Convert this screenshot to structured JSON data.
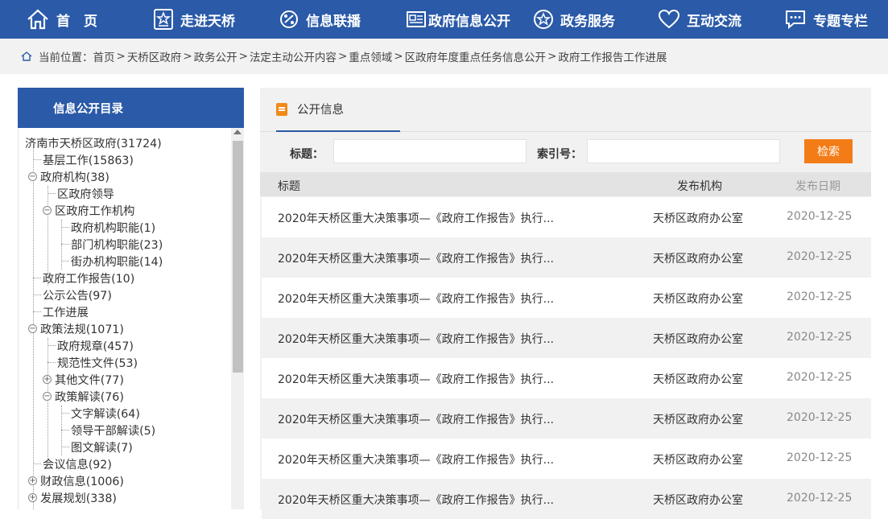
{
  "nav": {
    "items": [
      {
        "label": "首　页",
        "icon": "home-icon"
      },
      {
        "label": "走进天桥",
        "icon": "star-badge-icon"
      },
      {
        "label": "信息联播",
        "icon": "broadcast-icon"
      },
      {
        "label": "政府信息公开",
        "icon": "document-icon"
      },
      {
        "label": "政务服务",
        "icon": "star-circle-icon"
      },
      {
        "label": "互动交流",
        "icon": "heart-icon"
      },
      {
        "label": "专题专栏",
        "icon": "chat-icon"
      }
    ]
  },
  "breadcrumb": {
    "prefix": "当前位置：",
    "items": [
      "首页",
      "天桥区政府",
      "政务公开",
      "法定主动公开内容",
      "重点领域",
      "区政府年度重点任务信息公开",
      "政府工作报告工作进展"
    ],
    "separator": ">"
  },
  "sidebar": {
    "title": "信息公开目录",
    "tree": [
      {
        "label": "济南市天桥区政府(31724)"
      },
      {
        "label": "基层工作(15863)"
      },
      {
        "label": "政府机构(38)"
      },
      {
        "label": "区政府领导"
      },
      {
        "label": "区政府工作机构"
      },
      {
        "label": "政府机构职能(1)"
      },
      {
        "label": "部门机构职能(23)"
      },
      {
        "label": "街办机构职能(14)"
      },
      {
        "label": "政府工作报告(10)"
      },
      {
        "label": "公示公告(97)"
      },
      {
        "label": "工作进展"
      },
      {
        "label": "政策法规(1071)"
      },
      {
        "label": "政府规章(457)"
      },
      {
        "label": "规范性文件(53)"
      },
      {
        "label": "其他文件(77)"
      },
      {
        "label": "政策解读(76)"
      },
      {
        "label": "文字解读(64)"
      },
      {
        "label": "领导干部解读(5)"
      },
      {
        "label": "图文解读(7)"
      },
      {
        "label": "会议信息(92)"
      },
      {
        "label": "财政信息(1006)"
      },
      {
        "label": "发展规划(338)"
      }
    ]
  },
  "main": {
    "tab_label": "公开信息",
    "search": {
      "title_label": "标题：",
      "title_value": "",
      "index_label": "索引号：",
      "index_value": "",
      "button_label": "检索"
    },
    "columns": {
      "title": "标题",
      "org": "发布机构",
      "date": "发布日期"
    },
    "rows": [
      {
        "title": "2020年天桥区重大决策事项—《政府工作报告》执行...",
        "org": "天桥区政府办公室",
        "date": "2020-12-25"
      },
      {
        "title": "2020年天桥区重大决策事项—《政府工作报告》执行...",
        "org": "天桥区政府办公室",
        "date": "2020-12-25"
      },
      {
        "title": "2020年天桥区重大决策事项—《政府工作报告》执行...",
        "org": "天桥区政府办公室",
        "date": "2020-12-25"
      },
      {
        "title": "2020年天桥区重大决策事项—《政府工作报告》执行...",
        "org": "天桥区政府办公室",
        "date": "2020-12-25"
      },
      {
        "title": "2020年天桥区重大决策事项—《政府工作报告》执行...",
        "org": "天桥区政府办公室",
        "date": "2020-12-25"
      },
      {
        "title": "2020年天桥区重大决策事项—《政府工作报告》执行...",
        "org": "天桥区政府办公室",
        "date": "2020-12-25"
      },
      {
        "title": "2020年天桥区重大决策事项—《政府工作报告》执行...",
        "org": "天桥区政府办公室",
        "date": "2020-12-25"
      },
      {
        "title": "2020年天桥区重大决策事项—《政府工作报告》执行...",
        "org": "天桥区政府办公室",
        "date": "2020-12-25"
      }
    ]
  },
  "colors": {
    "primary": "#2a5aa8",
    "accent": "#f47c17"
  }
}
